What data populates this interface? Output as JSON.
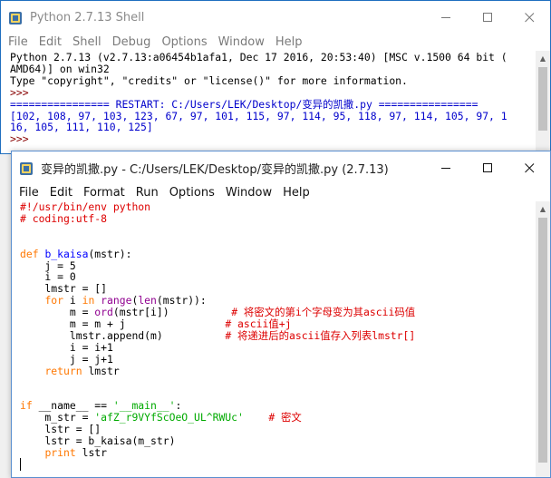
{
  "shell": {
    "title": "Python 2.7.13 Shell",
    "menu": [
      "File",
      "Edit",
      "Shell",
      "Debug",
      "Options",
      "Window",
      "Help"
    ],
    "lines": [
      "Python 2.7.13 (v2.7.13:a06454b1afa1, Dec 17 2016, 20:53:40) [MSC v.1500 64 bit (",
      "AMD64)] on win32",
      "Type \"copyright\", \"credits\" or \"license()\" for more information.",
      ">>> ",
      "================ RESTART: C:/Users/LEK/Desktop/变异的凯撒.py ================",
      "[102, 108, 97, 103, 123, 67, 97, 101, 115, 97, 114, 95, 118, 97, 114, 105, 97, 1",
      "16, 105, 111, 110, 125]",
      ">>> "
    ]
  },
  "editor": {
    "title": "变异的凯撒.py - C:/Users/LEK/Desktop/变异的凯撒.py (2.7.13)",
    "menu": [
      "File",
      "Edit",
      "Format",
      "Run",
      "Options",
      "Window",
      "Help"
    ]
  },
  "colors": {
    "keyword": "#ff7700",
    "builtin": "#900090",
    "comment": "#dd0000",
    "string": "#00aa00",
    "definition": "#0000ff",
    "output": "#0000cc"
  },
  "icons": [
    "python-icon",
    "minimize-icon",
    "maximize-icon",
    "close-icon"
  ]
}
